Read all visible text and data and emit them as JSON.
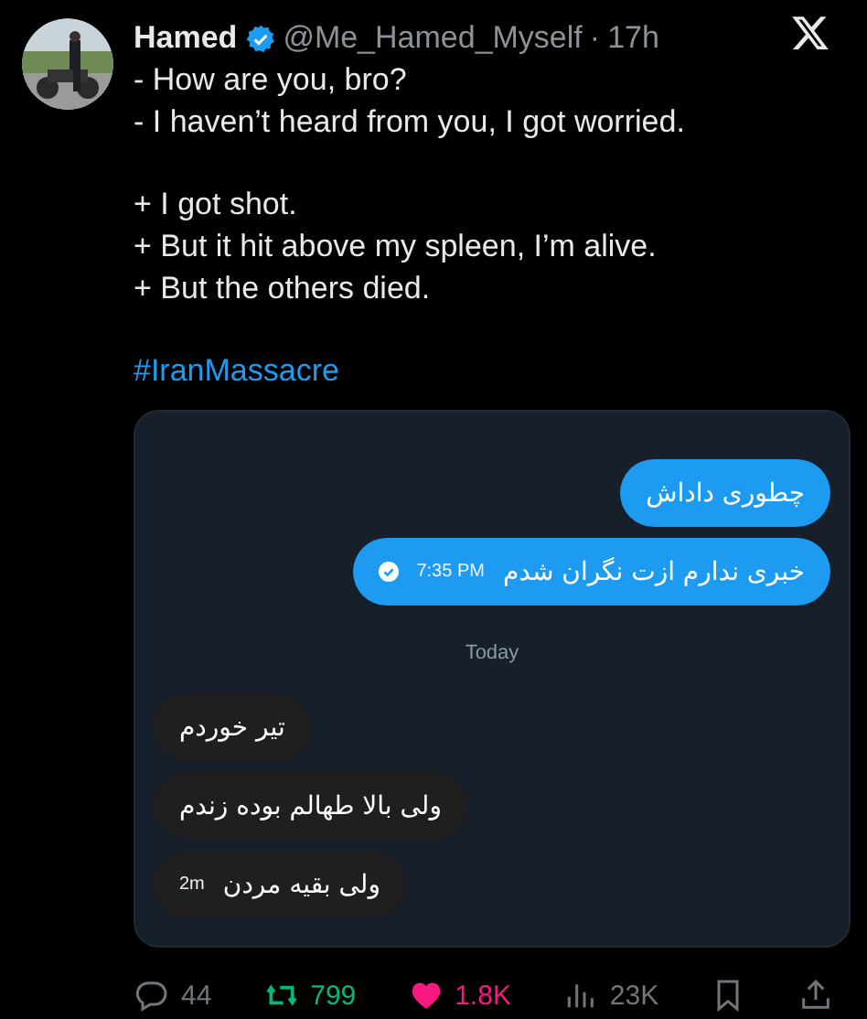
{
  "author": {
    "name": "Hamed",
    "verified": true,
    "handle": "@Me_Hamed_Myself",
    "separator": "·",
    "time": "17h"
  },
  "paragraphs": [
    {
      "lines": [
        "- How are you, bro?",
        "- I haven’t heard from you, I got worried."
      ]
    },
    {
      "lines": [
        "+ I got shot.",
        "+ But it hit above my spleen, I’m alive.",
        "+ But the others died."
      ]
    }
  ],
  "hashtag": "#IranMassacre",
  "chat": {
    "messages": [
      {
        "kind": "sent",
        "text": "چطوری داداش"
      },
      {
        "kind": "sent",
        "text": "خبری ندارم ازت نگران شدم",
        "time": "7:35 PM",
        "read": true
      },
      {
        "kind": "divider",
        "text": "Today"
      },
      {
        "kind": "received",
        "text": "تیر خوردم"
      },
      {
        "kind": "received",
        "text": "ولی بالا طهالم بوده زندم"
      },
      {
        "kind": "received",
        "text": "ولی بقیه مردن",
        "time": "2m"
      }
    ]
  },
  "actions": [
    {
      "kind": "reply",
      "count": "44",
      "active": false
    },
    {
      "kind": "retweet",
      "count": "799",
      "active": true
    },
    {
      "kind": "like",
      "count": "1.8K",
      "active": true
    },
    {
      "kind": "views",
      "count": "23K",
      "active": false
    },
    {
      "kind": "bookmark",
      "active": false
    },
    {
      "kind": "share",
      "active": false
    }
  ]
}
